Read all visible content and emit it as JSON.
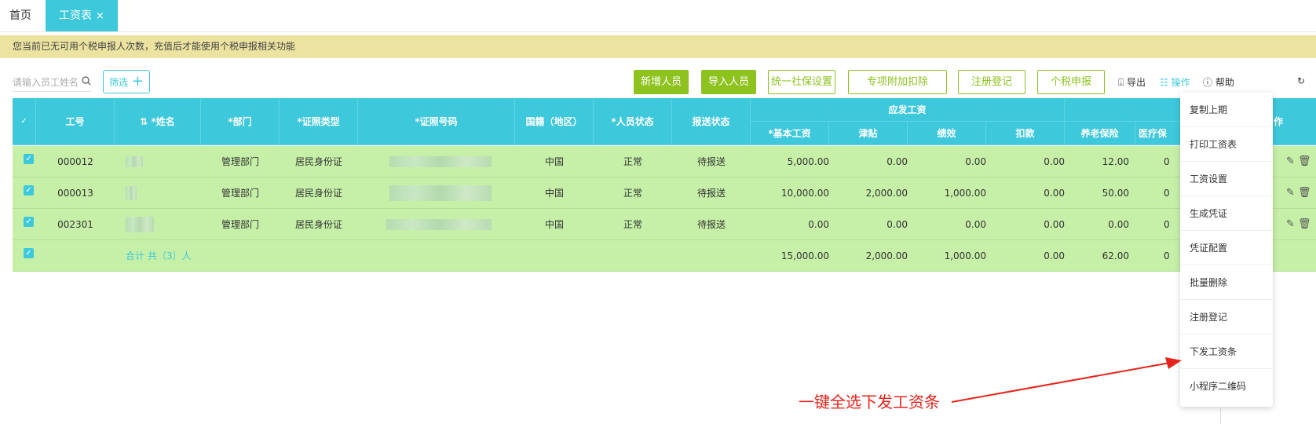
{
  "tabs": {
    "home": "首页",
    "active": "工资表",
    "close": "×"
  },
  "notice": "您当前已无可用个税申报人次数，充值后才能使用个税申报相关功能",
  "toolbar": {
    "search_placeholder": "请输入员工姓名",
    "filter": "筛选",
    "filter_plus": "+",
    "buttons": [
      "新增人员",
      "导入人员",
      "统一社保设置",
      "专项附加扣除",
      "注册登记",
      "个税申报"
    ],
    "export": "导出",
    "operate": "操作",
    "help": "帮助"
  },
  "table": {
    "headers": {
      "id": "工号",
      "name": "*姓名",
      "dept": "*部门",
      "idtype": "*证照类型",
      "idno": "*证照号码",
      "nation": "国籍（地区）",
      "status": "*人员状态",
      "send": "报送状态",
      "group": "应发工资",
      "base": "*基本工资",
      "allow": "津贴",
      "perf": "绩效",
      "deduct": "扣款",
      "pension": "养老保险",
      "medical": "医疗保",
      "op": "作"
    },
    "rows": [
      {
        "id": "000012",
        "dept": "管理部门",
        "idtype": "居民身份证",
        "nation": "中国",
        "status": "正常",
        "send": "待报送",
        "base": "5,000.00",
        "allow": "0.00",
        "perf": "0.00",
        "deduct": "0.00",
        "pension": "12.00",
        "medical": "0"
      },
      {
        "id": "000013",
        "dept": "管理部门",
        "idtype": "居民身份证",
        "nation": "中国",
        "status": "正常",
        "send": "待报送",
        "base": "10,000.00",
        "allow": "2,000.00",
        "perf": "1,000.00",
        "deduct": "0.00",
        "pension": "50.00",
        "medical": "0"
      },
      {
        "id": "002301",
        "dept": "管理部门",
        "idtype": "居民身份证",
        "nation": "中国",
        "status": "正常",
        "send": "待报送",
        "base": "0.00",
        "allow": "0.00",
        "perf": "0.00",
        "deduct": "0.00",
        "pension": "0.00",
        "medical": "0"
      }
    ],
    "total": {
      "label": "合计 共（3）人",
      "base": "15,000.00",
      "allow": "2,000.00",
      "perf": "1,000.00",
      "deduct": "0.00",
      "pension": "62.00",
      "medical": "0"
    }
  },
  "menu": [
    "复制上期",
    "打印工资表",
    "工资设置",
    "生成凭证",
    "凭证配置",
    "批量删除",
    "注册登记",
    "下发工资条",
    "小程序二维码"
  ],
  "annotation": "一键全选下发工资条",
  "colors": {
    "primary": "#3ec8dc",
    "green": "#8dc21f",
    "row": "#c6f0a8",
    "notice": "#ece3a0",
    "annotation": "#e8231b"
  }
}
